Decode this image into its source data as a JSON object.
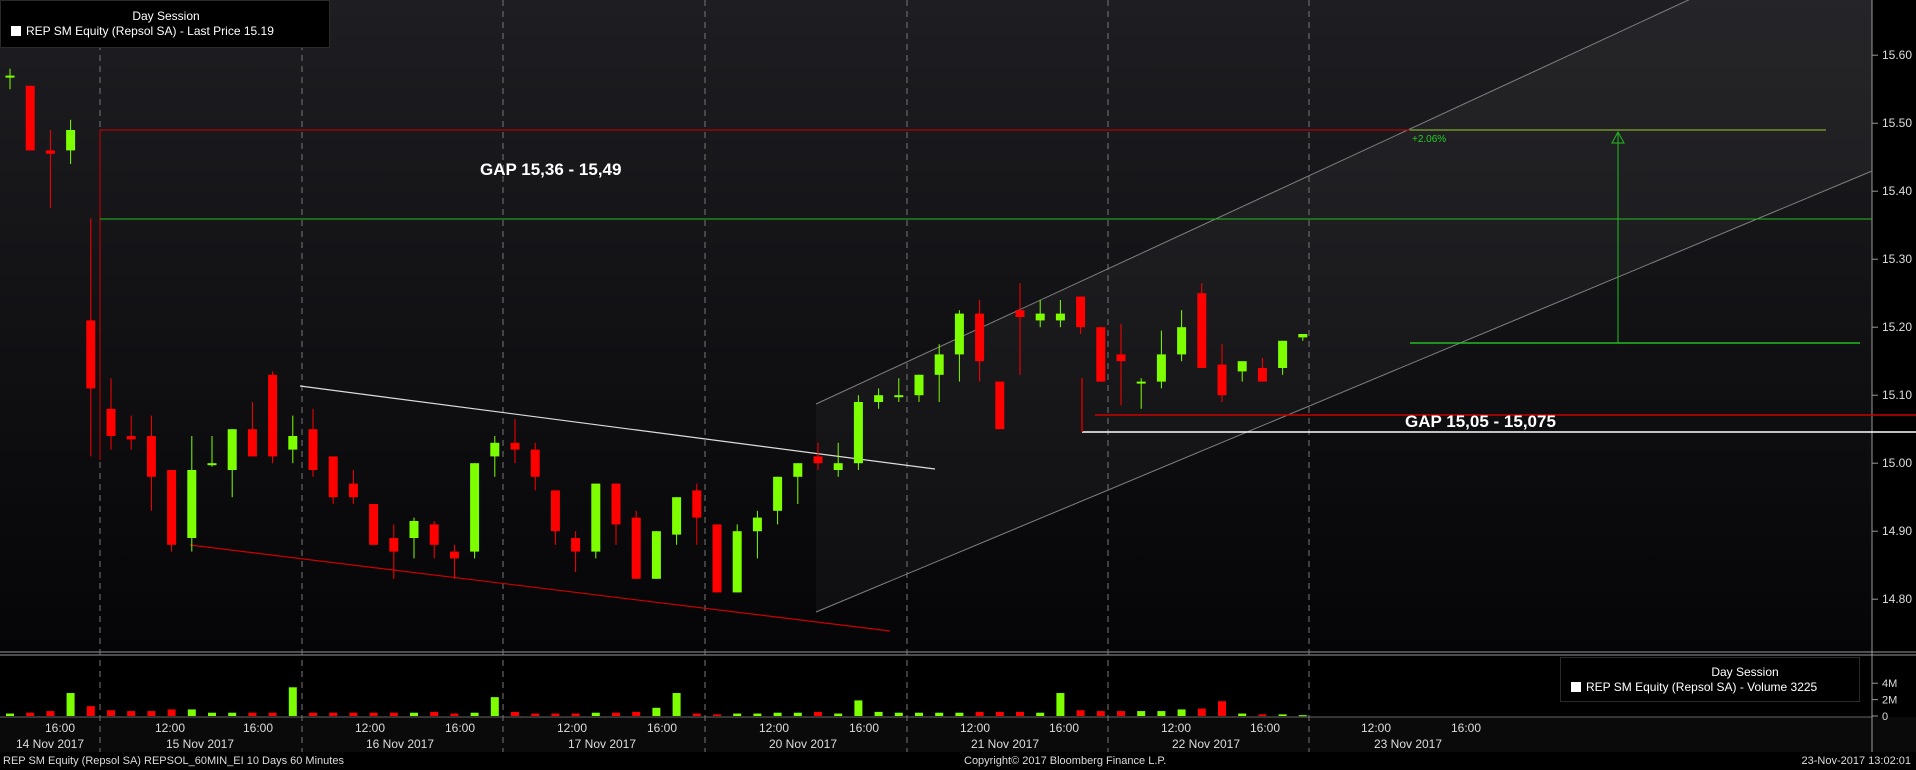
{
  "legend_top": {
    "header": "Day Session",
    "label": "REP SM Equity (Repsol SA) - Last Price 15.19",
    "swatch_color": "#ffffff"
  },
  "legend_volume": {
    "header": "Day Session",
    "label": "REP SM Equity (Repsol SA) - Volume 3225",
    "swatch_color": "#ffffff"
  },
  "footer": {
    "left": "REP SM Equity (Repsol SA) REPSOL_60MIN_EI 10 Days 60 Minutes",
    "center": "Copyright© 2017 Bloomberg Finance L.P.",
    "right": "23-Nov-2017 13:02:01"
  },
  "colors": {
    "up": "#7dff00",
    "down": "#ff0000",
    "background": "#000000",
    "gap_line": "#cc0000",
    "target_line": "#22bb22"
  },
  "chart_data": [
    {
      "type": "candlestick",
      "title": "REP SM Equity (Repsol SA) - Last Price 15.19",
      "interval": "60 Minutes",
      "ylim": [
        14.73,
        15.68
      ],
      "yticks": [
        "14.80",
        "14.90",
        "15.00",
        "15.10",
        "15.20",
        "15.30",
        "15.40",
        "15.50",
        "15.60"
      ],
      "time_labels": [
        "16:00",
        "12:00",
        "16:00",
        "12:00",
        "16:00",
        "12:00",
        "16:00",
        "12:00",
        "16:00",
        "12:00",
        "16:00",
        "12:00",
        "16:00",
        "12:00",
        "16:00"
      ],
      "date_labels": [
        "14 Nov 2017",
        "15 Nov 2017",
        "16 Nov 2017",
        "17 Nov 2017",
        "20 Nov 2017",
        "21 Nov 2017",
        "22 Nov 2017",
        "23 Nov 2017"
      ],
      "candles": [
        {
          "o": 15.57,
          "h": 15.58,
          "l": 15.55,
          "c": 15.57
        },
        {
          "o": 15.555,
          "h": 15.555,
          "l": 15.495,
          "c": 15.46
        },
        {
          "o": 15.46,
          "h": 15.49,
          "l": 15.375,
          "c": 15.455
        },
        {
          "o": 15.46,
          "h": 15.505,
          "l": 15.44,
          "c": 15.49
        },
        {
          "o": 15.21,
          "h": 15.36,
          "l": 15.01,
          "c": 15.11
        },
        {
          "o": 15.08,
          "h": 15.125,
          "l": 15.02,
          "c": 15.04
        },
        {
          "o": 15.04,
          "h": 15.07,
          "l": 15.02,
          "c": 15.035
        },
        {
          "o": 15.04,
          "h": 15.07,
          "l": 14.93,
          "c": 14.98
        },
        {
          "o": 14.99,
          "h": 14.99,
          "l": 14.87,
          "c": 14.88
        },
        {
          "o": 14.89,
          "h": 15.04,
          "l": 14.87,
          "c": 14.99
        },
        {
          "o": 15.0,
          "h": 15.04,
          "l": 14.995,
          "c": 15.0
        },
        {
          "o": 14.99,
          "h": 15.05,
          "l": 14.95,
          "c": 15.05
        },
        {
          "o": 15.05,
          "h": 15.09,
          "l": 15.01,
          "c": 15.01
        },
        {
          "o": 15.13,
          "h": 15.135,
          "l": 15.0,
          "c": 15.01
        },
        {
          "o": 15.02,
          "h": 15.07,
          "l": 15.0,
          "c": 15.04
        },
        {
          "o": 15.05,
          "h": 15.08,
          "l": 14.98,
          "c": 14.99
        },
        {
          "o": 15.01,
          "h": 15.01,
          "l": 14.94,
          "c": 14.95
        },
        {
          "o": 14.97,
          "h": 14.99,
          "l": 14.94,
          "c": 14.95
        },
        {
          "o": 14.94,
          "h": 14.94,
          "l": 14.88,
          "c": 14.88
        },
        {
          "o": 14.89,
          "h": 14.91,
          "l": 14.83,
          "c": 14.87
        },
        {
          "o": 14.89,
          "h": 14.92,
          "l": 14.86,
          "c": 14.915
        },
        {
          "o": 14.91,
          "h": 14.915,
          "l": 14.86,
          "c": 14.88
        },
        {
          "o": 14.87,
          "h": 14.88,
          "l": 14.83,
          "c": 14.86
        },
        {
          "o": 14.87,
          "h": 15.0,
          "l": 14.86,
          "c": 15.0
        },
        {
          "o": 15.01,
          "h": 15.04,
          "l": 14.98,
          "c": 15.03
        },
        {
          "o": 15.03,
          "h": 15.065,
          "l": 15.0,
          "c": 15.02
        },
        {
          "o": 15.02,
          "h": 15.03,
          "l": 14.96,
          "c": 14.98
        },
        {
          "o": 14.96,
          "h": 14.96,
          "l": 14.88,
          "c": 14.9
        },
        {
          "o": 14.89,
          "h": 14.9,
          "l": 14.84,
          "c": 14.87
        },
        {
          "o": 14.87,
          "h": 14.97,
          "l": 14.86,
          "c": 14.97
        },
        {
          "o": 14.97,
          "h": 14.97,
          "l": 14.88,
          "c": 14.91
        },
        {
          "o": 14.92,
          "h": 14.93,
          "l": 14.83,
          "c": 14.83
        },
        {
          "o": 14.83,
          "h": 14.9,
          "l": 14.83,
          "c": 14.9
        },
        {
          "o": 14.895,
          "h": 14.95,
          "l": 14.88,
          "c": 14.95
        },
        {
          "o": 14.96,
          "h": 14.97,
          "l": 14.88,
          "c": 14.92
        },
        {
          "o": 14.91,
          "h": 14.91,
          "l": 14.81,
          "c": 14.81
        },
        {
          "o": 14.81,
          "h": 14.91,
          "l": 14.81,
          "c": 14.9
        },
        {
          "o": 14.9,
          "h": 14.93,
          "l": 14.86,
          "c": 14.92
        },
        {
          "o": 14.93,
          "h": 14.98,
          "l": 14.91,
          "c": 14.98
        },
        {
          "o": 14.98,
          "h": 15.0,
          "l": 14.94,
          "c": 15.0
        },
        {
          "o": 15.01,
          "h": 15.03,
          "l": 14.99,
          "c": 15.0
        },
        {
          "o": 14.99,
          "h": 15.03,
          "l": 14.98,
          "c": 15.0
        },
        {
          "o": 15.0,
          "h": 15.1,
          "l": 14.99,
          "c": 15.09
        },
        {
          "o": 15.09,
          "h": 15.11,
          "l": 15.08,
          "c": 15.1
        },
        {
          "o": 15.1,
          "h": 15.125,
          "l": 15.09,
          "c": 15.1
        },
        {
          "o": 15.1,
          "h": 15.13,
          "l": 15.09,
          "c": 15.13
        },
        {
          "o": 15.13,
          "h": 15.175,
          "l": 15.09,
          "c": 15.16
        },
        {
          "o": 15.16,
          "h": 15.225,
          "l": 15.12,
          "c": 15.22
        },
        {
          "o": 15.22,
          "h": 15.24,
          "l": 15.12,
          "c": 15.15
        },
        {
          "o": 15.12,
          "h": 15.12,
          "l": 15.05,
          "c": 15.05
        },
        {
          "o": 15.225,
          "h": 15.265,
          "l": 15.13,
          "c": 15.215
        },
        {
          "o": 15.21,
          "h": 15.24,
          "l": 15.2,
          "c": 15.22
        },
        {
          "o": 15.21,
          "h": 15.24,
          "l": 15.2,
          "c": 15.22
        },
        {
          "o": 15.245,
          "h": 15.245,
          "l": 15.19,
          "c": 15.2
        },
        {
          "o": 15.2,
          "h": 15.2,
          "l": 15.12,
          "c": 15.12
        },
        {
          "o": 15.16,
          "h": 15.205,
          "l": 15.085,
          "c": 15.15
        },
        {
          "o": 15.12,
          "h": 15.125,
          "l": 15.08,
          "c": 15.12
        },
        {
          "o": 15.12,
          "h": 15.195,
          "l": 15.11,
          "c": 15.16
        },
        {
          "o": 15.16,
          "h": 15.225,
          "l": 15.15,
          "c": 15.2
        },
        {
          "o": 15.25,
          "h": 15.265,
          "l": 15.14,
          "c": 15.14
        },
        {
          "o": 15.145,
          "h": 15.175,
          "l": 15.09,
          "c": 15.1
        },
        {
          "o": 15.135,
          "h": 15.15,
          "l": 15.12,
          "c": 15.15
        },
        {
          "o": 15.14,
          "h": 15.155,
          "l": 15.12,
          "c": 15.12
        },
        {
          "o": 15.14,
          "h": 15.18,
          "l": 15.13,
          "c": 15.18
        },
        {
          "o": 15.185,
          "h": 15.19,
          "l": 15.18,
          "c": 15.19
        }
      ],
      "annotations": [
        {
          "text": "GAP 15,36 - 15,49",
          "low": 15.36,
          "high": 15.49
        },
        {
          "text": "GAP 15,05 - 15,075",
          "low": 15.05,
          "high": 15.075
        },
        {
          "text": "+2.06%",
          "from": 15.18,
          "to": 15.49
        }
      ]
    },
    {
      "type": "bar",
      "title": "REP SM Equity (Repsol SA) - Volume 3225",
      "ylim": [
        0,
        4.8
      ],
      "unit": "M",
      "yticks": [
        "4M",
        "2M",
        "0"
      ],
      "values": [
        0.3,
        0.4,
        0.6,
        2.8,
        1.2,
        0.7,
        0.6,
        0.6,
        0.8,
        0.8,
        0.4,
        0.4,
        0.4,
        0.4,
        3.5,
        0.4,
        0.4,
        0.4,
        0.4,
        0.4,
        0.4,
        0.5,
        0.3,
        0.4,
        2.3,
        0.5,
        0.3,
        0.3,
        0.3,
        0.4,
        0.4,
        0.5,
        1.0,
        2.8,
        0.3,
        0.2,
        0.3,
        0.3,
        0.4,
        0.4,
        0.5,
        0.3,
        1.9,
        0.5,
        0.4,
        0.4,
        0.4,
        0.4,
        0.5,
        0.5,
        0.5,
        0.4,
        2.8,
        0.7,
        0.6,
        0.6,
        0.6,
        0.6,
        0.8,
        0.9,
        1.8,
        0.3,
        0.2,
        0.2,
        0.1
      ]
    }
  ]
}
